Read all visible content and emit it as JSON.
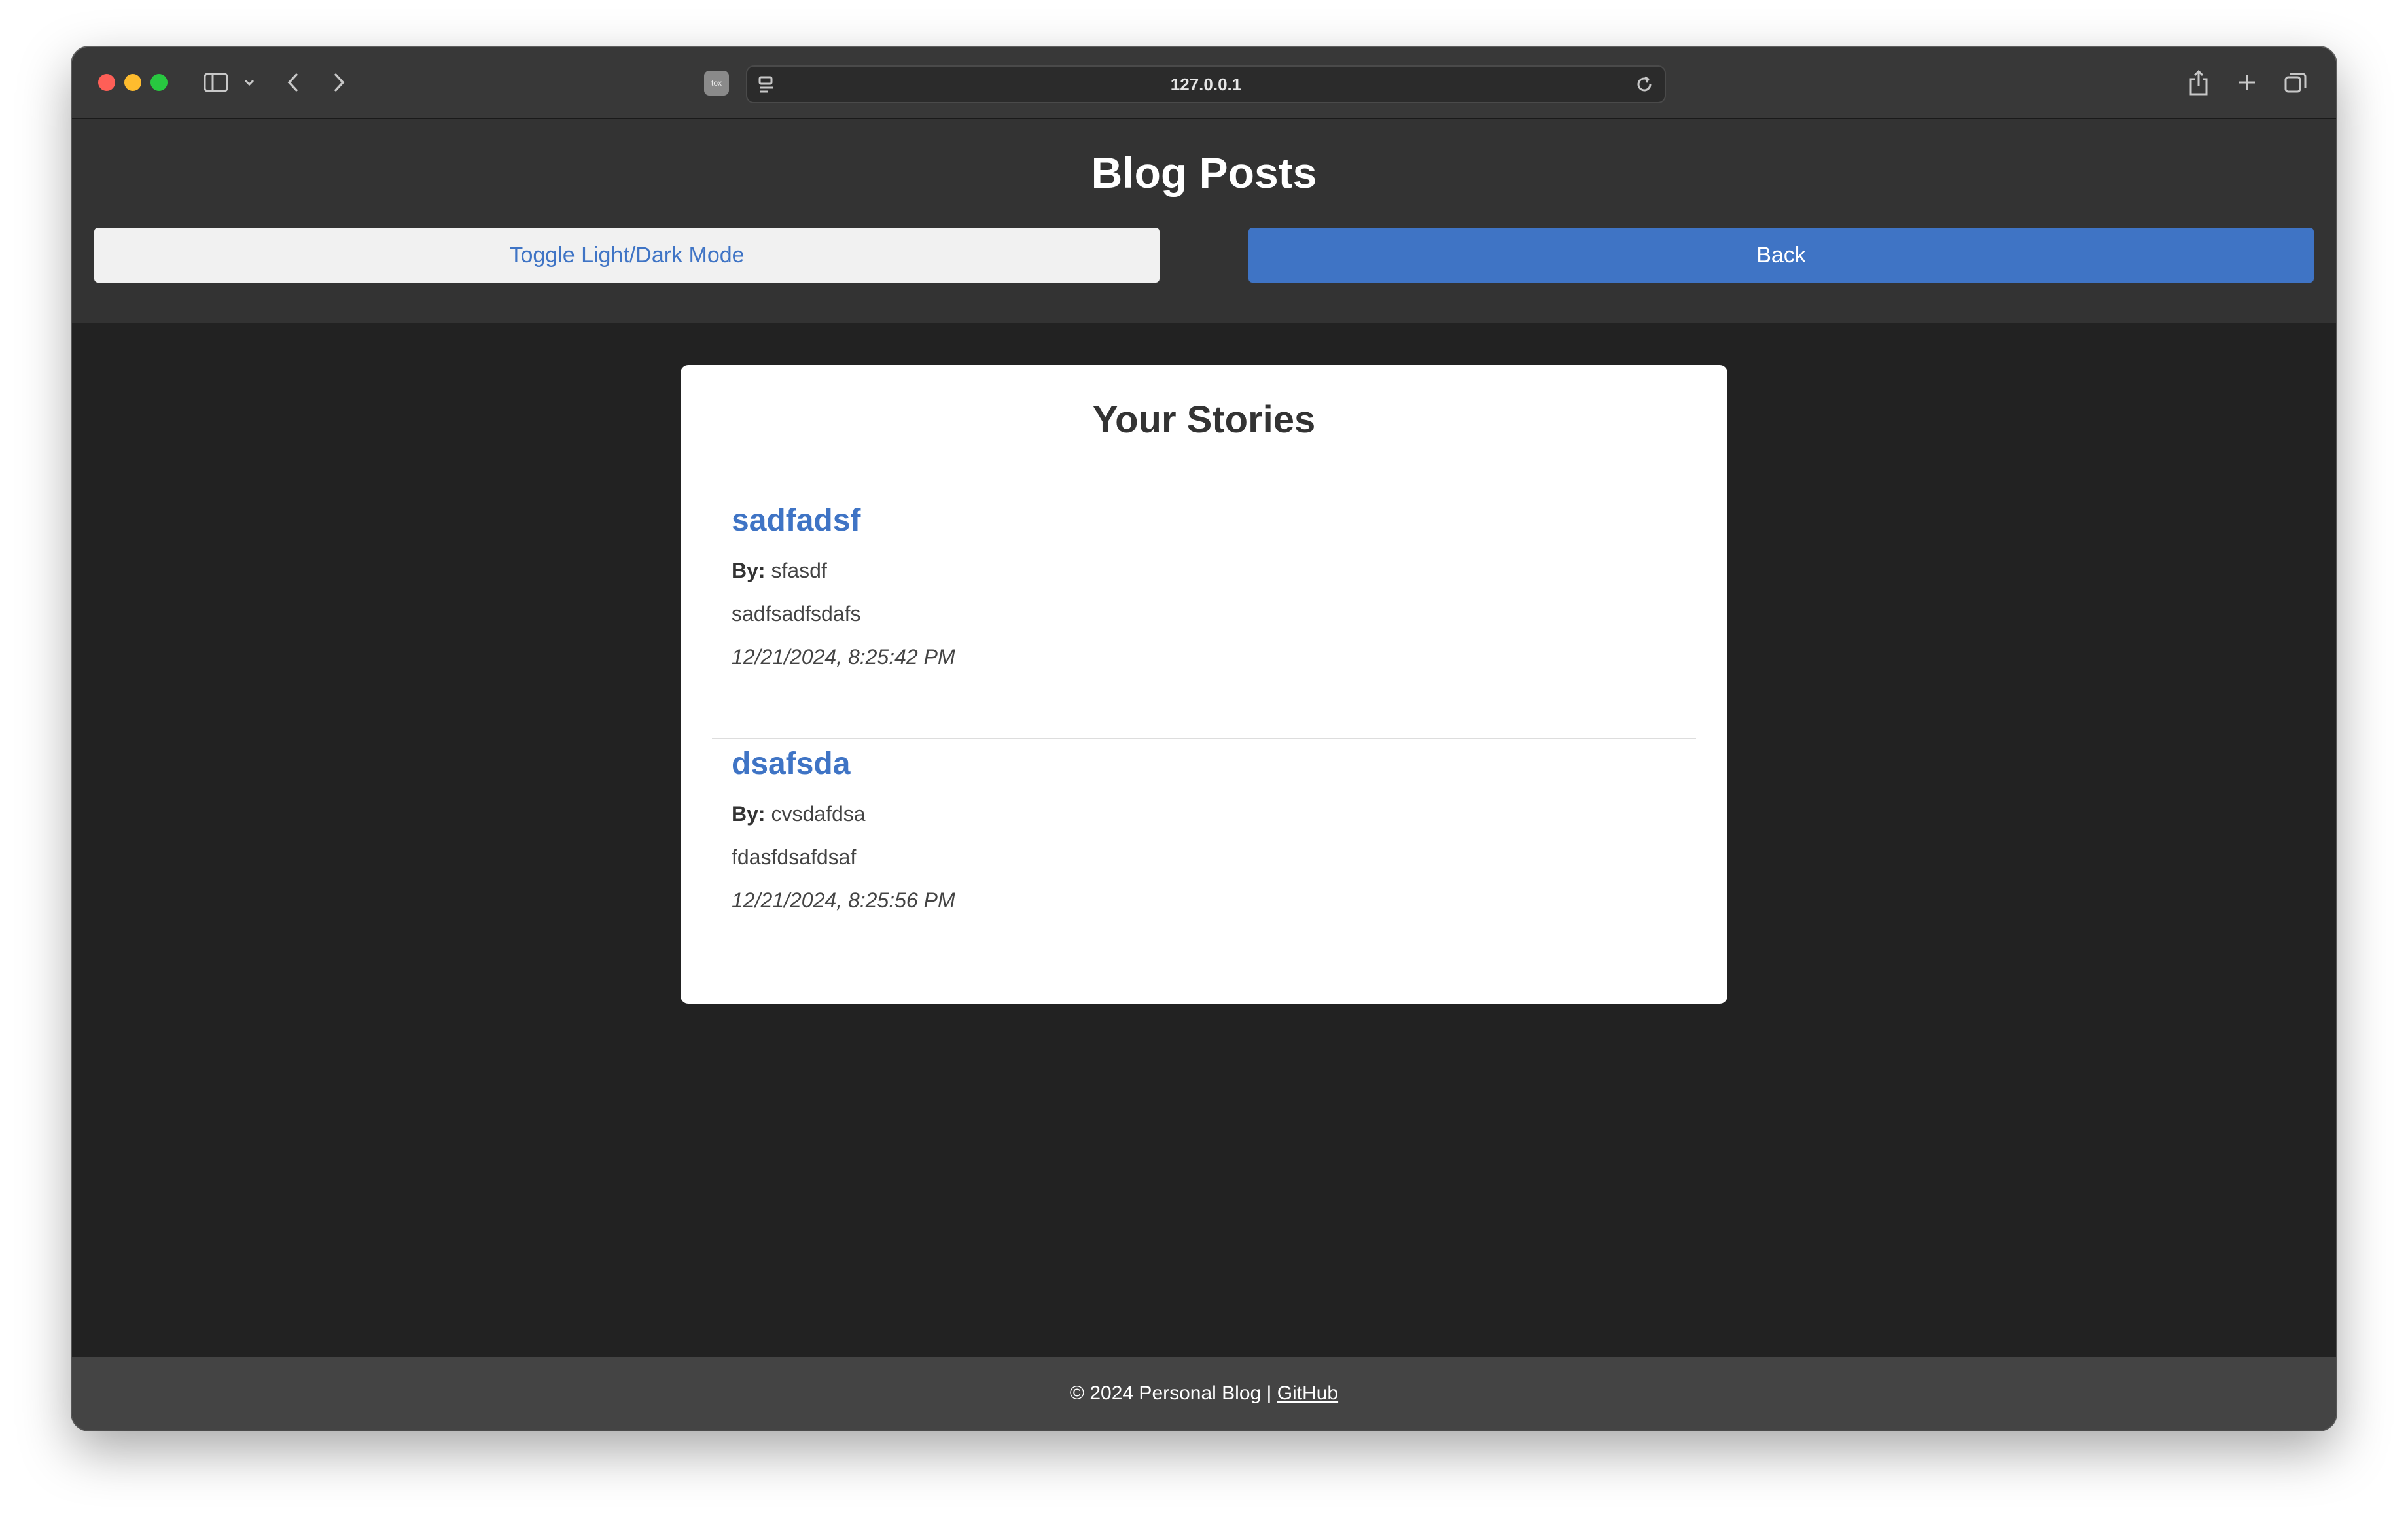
{
  "browser": {
    "url": "127.0.0.1",
    "favicon_text": "tox"
  },
  "header": {
    "title": "Blog Posts",
    "toggle_label": "Toggle Light/Dark Mode",
    "back_label": "Back"
  },
  "stories": {
    "heading": "Your Stories",
    "by_label": "By:",
    "posts": [
      {
        "title": "sadfadsf",
        "author": "sfasdf",
        "content": "sadfsadfsdafs",
        "date": "12/21/2024, 8:25:42 PM"
      },
      {
        "title": "dsafsda",
        "author": "cvsdafdsa",
        "content": "fdasfdsafdsaf",
        "date": "12/21/2024, 8:25:56 PM"
      }
    ]
  },
  "footer": {
    "copyright": "© 2024 Personal Blog |",
    "link_label": "GitHub"
  },
  "colors": {
    "accent": "#3f74c5",
    "header_bg": "#333333",
    "page_bg": "#222222",
    "footer_bg": "#444444"
  }
}
